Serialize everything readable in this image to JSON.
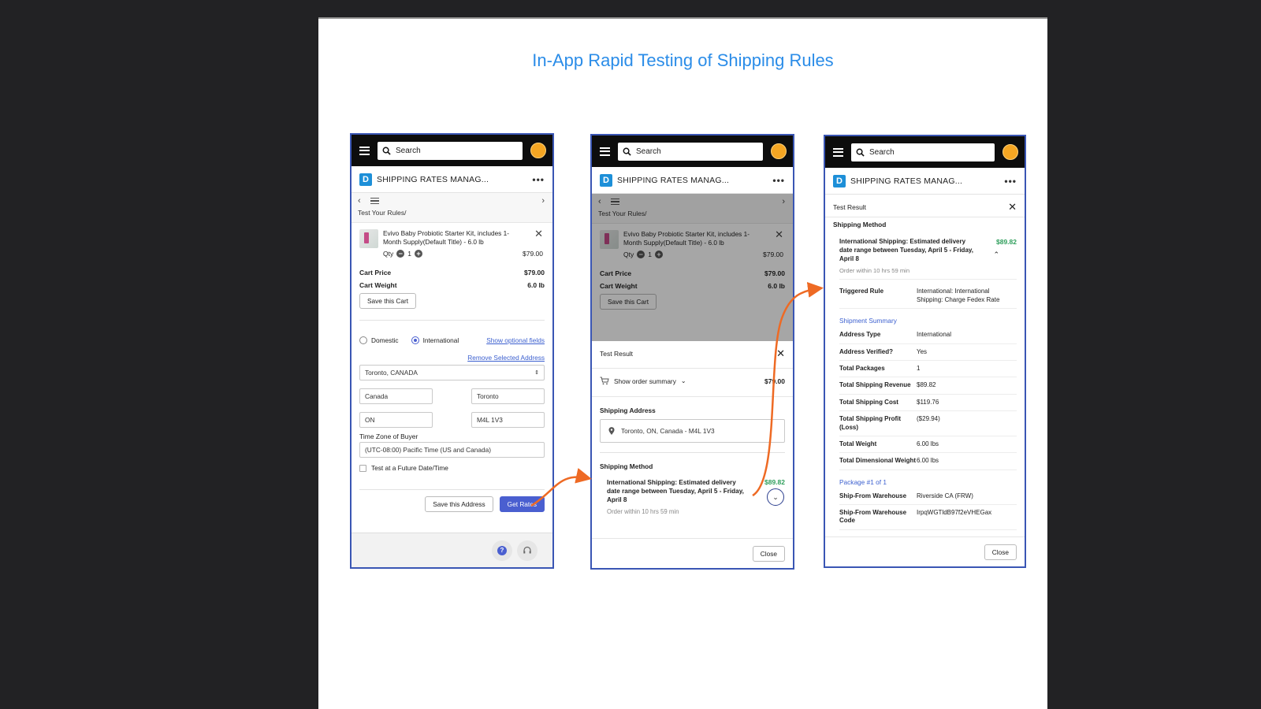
{
  "title": "In-App Rapid Testing of Shipping Rules",
  "common": {
    "search_placeholder": "Search",
    "app_name": "SHIPPING RATES MANAG...",
    "more_menu": "•••"
  },
  "screen1": {
    "breadcrumb": "Test Your Rules/",
    "product": {
      "name": "Evivo Baby Probiotic Starter Kit, includes 1-Month Supply(Default Title) - 6.0 lb",
      "qty_label": "Qty",
      "qty_value": "1",
      "price": "$79.00"
    },
    "cart_price_label": "Cart Price",
    "cart_price": "$79.00",
    "cart_weight_label": "Cart Weight",
    "cart_weight": "6.0 lb",
    "save_cart_label": "Save this Cart",
    "radio_domestic": "Domestic",
    "radio_international": "International",
    "show_optional_fields": "Show optional fields",
    "remove_selected_address": "Remove Selected Address",
    "address_select": "Toronto, CANADA",
    "country": "Canada",
    "city": "Toronto",
    "province": "ON",
    "postal": "M4L 1V3",
    "timezone_label": "Time Zone of Buyer",
    "timezone_value": "(UTC-08:00) Pacific Time (US and Canada)",
    "future_date_label": "Test at a Future Date/Time",
    "save_address_label": "Save this Address",
    "get_rates_label": "Get Rates"
  },
  "screen2": {
    "test_result_label": "Test Result",
    "order_summary_label": "Show order summary",
    "order_total": "$79.00",
    "shipping_address_label": "Shipping Address",
    "shipping_address_value": "Toronto, ON, Canada - M4L 1V3",
    "shipping_method_label": "Shipping Method",
    "method_description": "International Shipping: Estimated delivery date range between Tuesday, April 5 - Friday, April 8",
    "method_price": "$89.82",
    "order_within": "Order within 10 hrs 59 min",
    "close_label": "Close"
  },
  "screen3": {
    "test_result_label": "Test Result",
    "shipping_method_label": "Shipping Method",
    "method_description": "International Shipping: Estimated delivery date range between Tuesday, April 5 - Friday, April 8",
    "method_price": "$89.82",
    "order_within": "Order within 10 hrs 59 min",
    "triggered_rule_label": "Triggered Rule",
    "triggered_rule_value": "International: International Shipping: Charge Fedex Rate",
    "shipment_summary_label": "Shipment Summary",
    "rows": [
      {
        "k": "Address Type",
        "v": "International"
      },
      {
        "k": "Address Verified?",
        "v": "Yes"
      },
      {
        "k": "Total Packages",
        "v": "1"
      },
      {
        "k": "Total Shipping Revenue",
        "v": "$89.82"
      },
      {
        "k": "Total Shipping Cost",
        "v": "$119.76"
      },
      {
        "k": "Total Shipping Profit (Loss)",
        "v": "($29.94)"
      },
      {
        "k": "Total Weight",
        "v": "6.00 lbs"
      },
      {
        "k": "Total Dimensional Weight",
        "v": "6.00 lbs"
      }
    ],
    "package_label": "Package #1 of 1",
    "package_rows": [
      {
        "k": "Ship-From Warehouse",
        "v": "Riverside CA (FRW)"
      },
      {
        "k": "Ship-From Warehouse Code",
        "v": "IrpqWGTldB97f2eVHEGax"
      }
    ],
    "close_label": "Close"
  },
  "colors": {
    "title_blue": "#2a8ce8",
    "frame_blue": "#3a56b4",
    "arrow_orange": "#ee6a24",
    "price_green": "#2e9e5b",
    "primary_button": "#4a5fd0"
  }
}
